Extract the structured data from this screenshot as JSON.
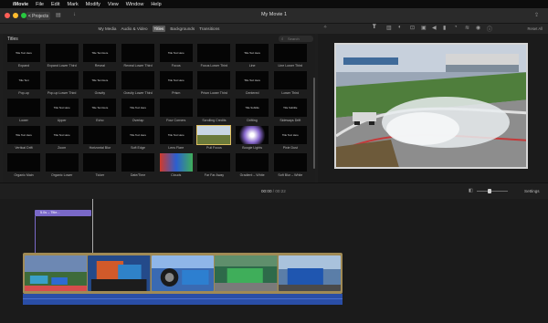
{
  "menubar": {
    "apple": "",
    "app": "iMovie",
    "items": [
      "File",
      "Edit",
      "Mark",
      "Modify",
      "View",
      "Window",
      "Help"
    ]
  },
  "toolbar": {
    "projects_label": "< Projects",
    "window_title": "My Movie 1"
  },
  "browser_tabs": {
    "items": [
      "My Media",
      "Audio & Video",
      "Titles",
      "Backgrounds",
      "Transitions"
    ],
    "active": "Titles"
  },
  "viewer_tools": {
    "reset_all": "Reset All"
  },
  "titles_panel": {
    "header": "Titles",
    "search_placeholder": "Search",
    "tiles": [
      {
        "label": "Expand",
        "thumb": "Title Text Here"
      },
      {
        "label": "Expand Lower Third",
        "thumb": ""
      },
      {
        "label": "Reveal",
        "thumb": "Title Text Here"
      },
      {
        "label": "Reveal Lower Third",
        "thumb": ""
      },
      {
        "label": "Focus",
        "thumb": "Title Text Here"
      },
      {
        "label": "Focus Lower Third",
        "thumb": ""
      },
      {
        "label": "Line",
        "thumb": "Title Text Here"
      },
      {
        "label": "Line Lower Third",
        "thumb": ""
      },
      {
        "label": "Pop-up",
        "thumb": "Title Text"
      },
      {
        "label": "Pop-up Lower Third",
        "thumb": ""
      },
      {
        "label": "Gravity",
        "thumb": "Title Text Here"
      },
      {
        "label": "Gravity Lower Third",
        "thumb": ""
      },
      {
        "label": "Prism",
        "thumb": "Title Text Here"
      },
      {
        "label": "Prism Lower Third",
        "thumb": ""
      },
      {
        "label": "Centered",
        "thumb": "Title Text Here"
      },
      {
        "label": "Lower Third",
        "thumb": ""
      },
      {
        "label": "Lower",
        "thumb": ""
      },
      {
        "label": "Upper",
        "thumb": "Title Text Here"
      },
      {
        "label": "Echo",
        "thumb": "Title Text Here"
      },
      {
        "label": "Overlap",
        "thumb": "Title Text Here"
      },
      {
        "label": "Four Corners",
        "thumb": ""
      },
      {
        "label": "Scrolling Credits",
        "thumb": ""
      },
      {
        "label": "Drifting",
        "thumb": "Title Subtitle"
      },
      {
        "label": "Sideways Drift",
        "thumb": "Title Subtitle"
      },
      {
        "label": "Vertical Drift",
        "thumb": "Title Text Here"
      },
      {
        "label": "Zoom",
        "thumb": "Title Text Here"
      },
      {
        "label": "Horizontal Blur",
        "thumb": ""
      },
      {
        "label": "Soft Edge",
        "thumb": "Title Text Here"
      },
      {
        "label": "Lens Flare",
        "thumb": "Title Text Here"
      },
      {
        "label": "Pull Focus",
        "thumb": ""
      },
      {
        "label": "Boogie Lights",
        "thumb": ""
      },
      {
        "label": "Pixie Dust",
        "thumb": "Title Text Here"
      },
      {
        "label": "Organic Main",
        "thumb": ""
      },
      {
        "label": "Organic Lower",
        "thumb": ""
      },
      {
        "label": "Ticker",
        "thumb": ""
      },
      {
        "label": "Date/Time",
        "thumb": ""
      },
      {
        "label": "Clouds",
        "thumb": ""
      },
      {
        "label": "Far Far Away",
        "thumb": ""
      },
      {
        "label": "Gradient – White",
        "thumb": ""
      },
      {
        "label": "Soft Blur – White",
        "thumb": ""
      }
    ]
  },
  "playbar": {
    "current_time": "00:00",
    "separator": "/",
    "total_time": "00:22",
    "settings_label": "Settings"
  },
  "timeline": {
    "title_clip_label": "5.0s – Title..."
  },
  "colors": {
    "title_clip": "#7a69c8",
    "audio_track": "#2a4ea6",
    "clip_border": "#a08a55"
  }
}
